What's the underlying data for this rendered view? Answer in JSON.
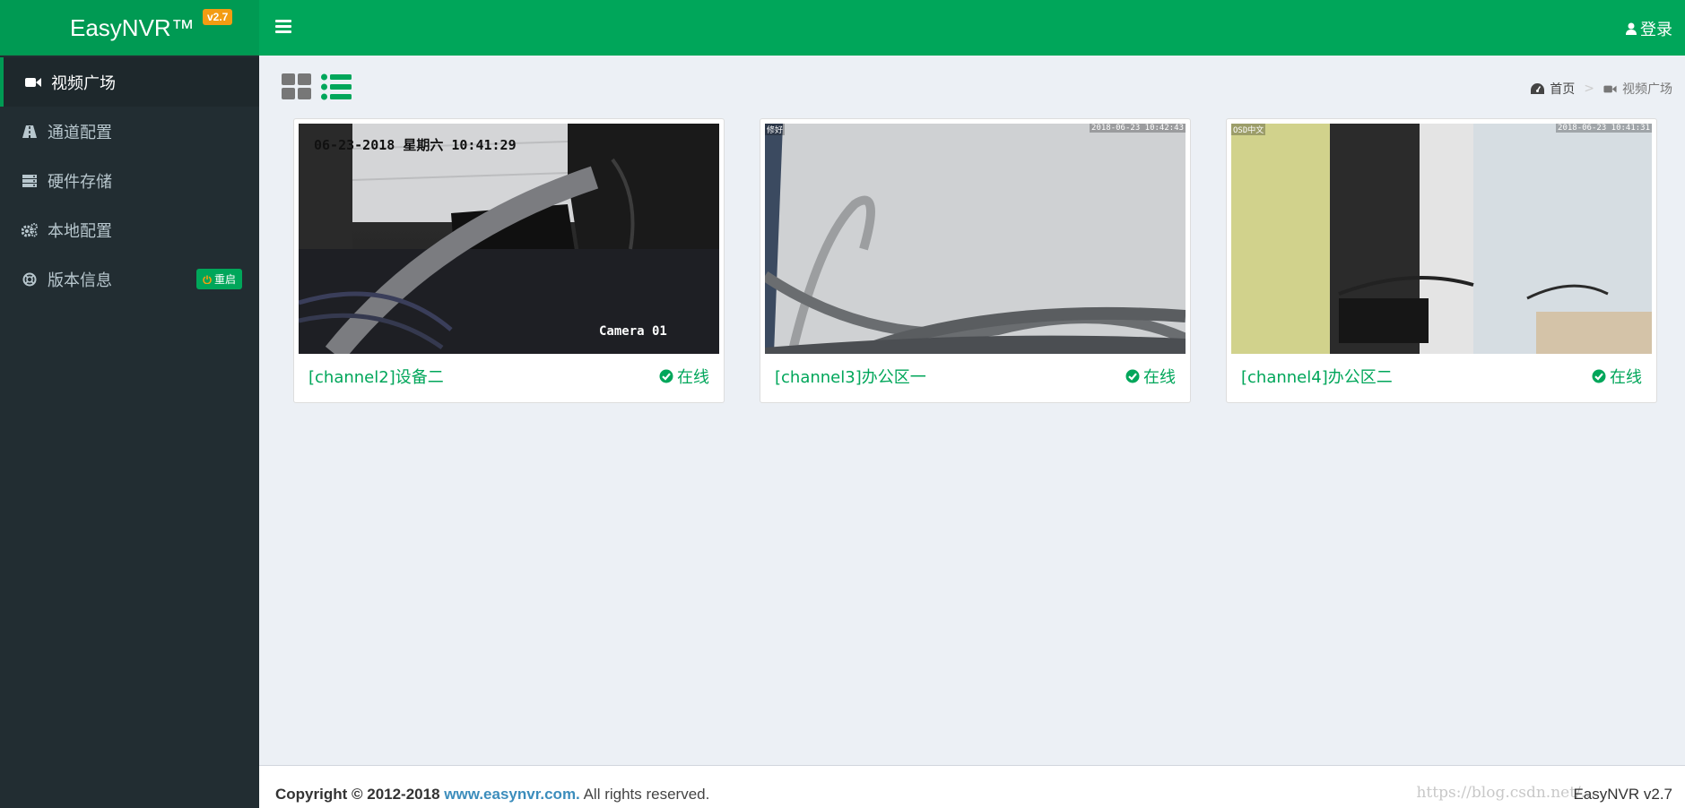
{
  "app": {
    "brand": "EasyNVR™",
    "version_badge": "v2.7"
  },
  "sidebar": {
    "items": [
      {
        "label": "视频广场",
        "icon": "video-camera-icon",
        "active": true
      },
      {
        "label": "通道配置",
        "icon": "road-icon",
        "active": false
      },
      {
        "label": "硬件存储",
        "icon": "server-icon",
        "active": false
      },
      {
        "label": "本地配置",
        "icon": "cogs-icon",
        "active": false
      },
      {
        "label": "版本信息",
        "icon": "life-ring-icon",
        "active": false
      }
    ],
    "restart_label": "重启"
  },
  "header": {
    "login_label": "登录"
  },
  "breadcrumb": {
    "home": "首页",
    "current": "视频广场"
  },
  "cards": [
    {
      "name": "[channel2]设备二",
      "status": "在线",
      "osd_top": "06-23-2018 星期六 10:41:29",
      "osd_bottom": "Camera 01"
    },
    {
      "name": "[channel3]办公区一",
      "status": "在线",
      "osd_tl": "修好",
      "osd_tr": "2018-06-23 10:42:43"
    },
    {
      "name": "[channel4]办公区二",
      "status": "在线",
      "osd_tl": "OSD中文",
      "osd_tr": "2018-06-23 10:41:31"
    }
  ],
  "footer": {
    "copyright_prefix": "Copyright © 2012-2018",
    "link": "www.easynvr.com.",
    "suffix": "All rights reserved.",
    "version": "EasyNVR v2.7",
    "watermark": "https://blog.csdn.net/..."
  },
  "colors": {
    "brand_green": "#00a65a",
    "sidebar_bg": "#222d32",
    "badge_orange": "#f39c12"
  }
}
